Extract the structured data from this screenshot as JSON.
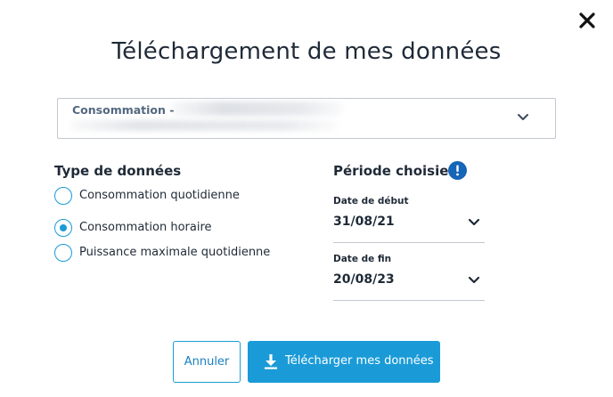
{
  "dialog": {
    "title": "Téléchargement de mes données",
    "close_icon": "close-icon"
  },
  "contract": {
    "label": "Consommation -",
    "chevron_icon": "chevron-down-icon"
  },
  "data_types": {
    "title": "Type de données",
    "options": [
      {
        "label": "Consommation quotidienne",
        "checked": false
      },
      {
        "label": "Consommation horaire",
        "checked": true
      },
      {
        "label": "Puissance maximale quotidienne",
        "checked": false
      }
    ]
  },
  "period": {
    "title": "Période choisie",
    "info_icon": "info-icon",
    "start": {
      "label": "Date de début",
      "value": "31/08/21"
    },
    "end": {
      "label": "Date de fin",
      "value": "20/08/23"
    }
  },
  "actions": {
    "cancel_label": "Annuler",
    "download_label": "Télécharger mes données",
    "download_icon": "download-icon"
  },
  "colors": {
    "accent": "#1a9bd7",
    "text": "#1f2a37",
    "info": "#1565b8",
    "muted_label": "#536880"
  }
}
